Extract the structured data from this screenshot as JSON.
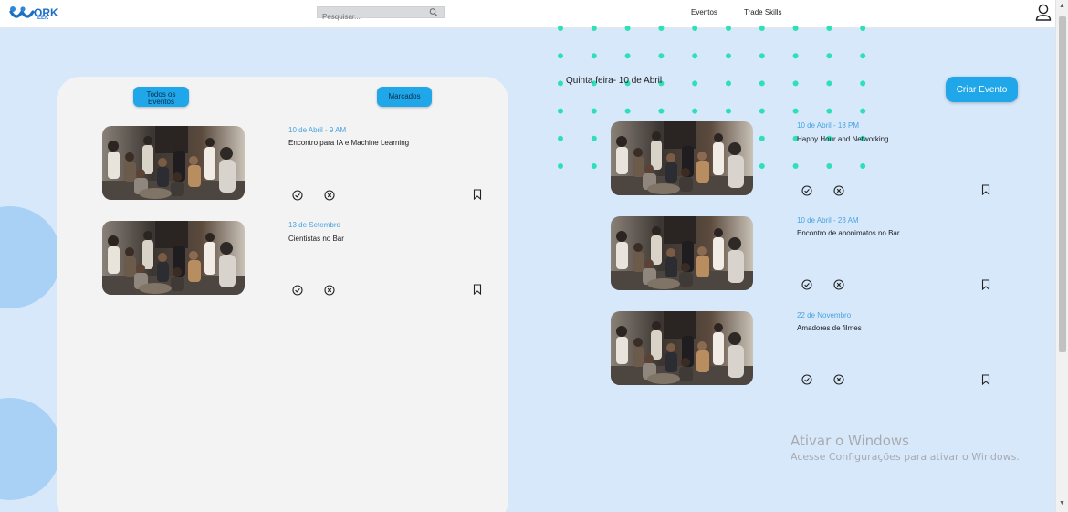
{
  "header": {
    "logo_text": "ORK",
    "logo_sub": "EEK",
    "search_placeholder": "Pesquisar...",
    "nav": [
      "Eventos",
      "Trade Skills"
    ]
  },
  "left_panel": {
    "filter_all_label": "Todos os Eventos",
    "filter_marked_label": "Marcados",
    "events": [
      {
        "date": "10 de Abril - 9 AM",
        "title": "Encontro para IA e Machine Learning"
      },
      {
        "date": "13 de Setembro",
        "title": "Cientistas no Bar"
      }
    ]
  },
  "right_panel": {
    "date_heading": "Quinta feira- 10 de Abril",
    "create_button": "Criar Evento",
    "events": [
      {
        "date": "10 de Abril - 18 PM",
        "title": "Happy Hour and Networking"
      },
      {
        "date": "10 de Abril - 23 AM",
        "title": "Encontro de anonimatos no Bar"
      },
      {
        "date": "22 de Novembro",
        "title": "Amadores de filmes"
      }
    ]
  },
  "icons": {
    "search": "search-icon",
    "user": "user-icon",
    "confirm": "check-circle-icon",
    "decline": "x-circle-icon",
    "bookmark": "bookmark-icon"
  },
  "colors": {
    "accent": "#1fa7ea",
    "background": "#d7e8fb",
    "panel": "#f3f3f4",
    "date_text": "#4aa3df",
    "dots": "#2ee0b6"
  },
  "watermark": {
    "title": "Ativar o Windows",
    "subtitle": "Acesse Configurações para ativar o Windows."
  }
}
